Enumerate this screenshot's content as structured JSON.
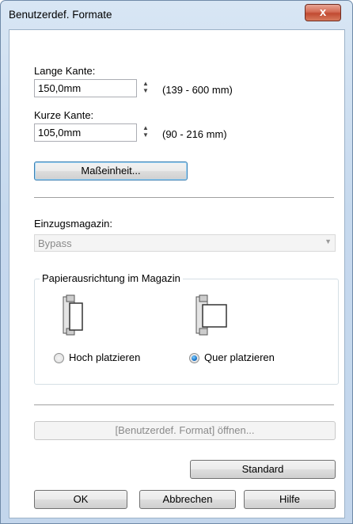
{
  "window": {
    "title": "Benutzerdef. Formate",
    "close_glyph": "x"
  },
  "long_edge": {
    "label": "Lange Kante:",
    "value": "150,0mm",
    "range": "(139 - 600 mm)"
  },
  "short_edge": {
    "label": "Kurze Kante:",
    "value": "105,0mm",
    "range": "(90 - 216 mm)"
  },
  "unit_button": "Maßeinheit...",
  "tray": {
    "label": "Einzugsmagazin:",
    "value": "Bypass"
  },
  "orientation": {
    "title": "Papierausrichtung im Magazin",
    "portrait_label": "Hoch platzieren",
    "landscape_label": "Quer platzieren",
    "selected": "landscape"
  },
  "open_button": "[Benutzerdef. Format] öffnen...",
  "standard_button": "Standard",
  "ok_button": "OK",
  "cancel_button": "Abbrechen",
  "help_button": "Hilfe"
}
